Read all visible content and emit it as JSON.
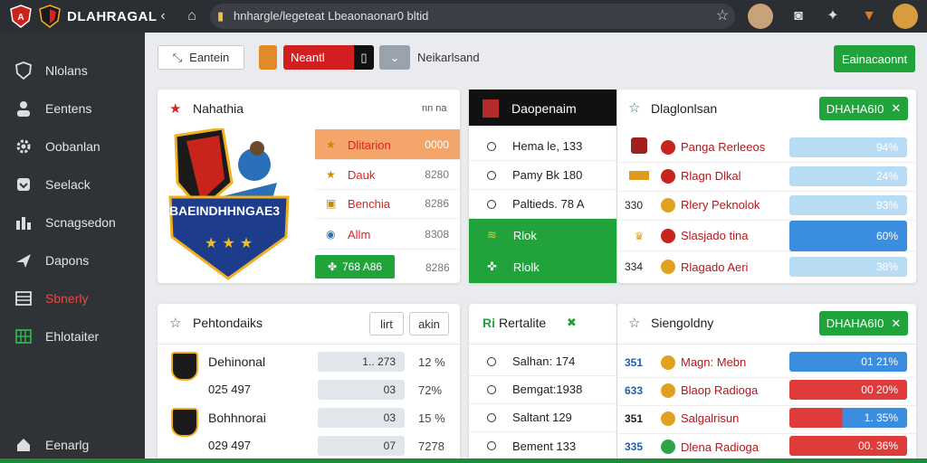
{
  "app": {
    "brand": "DLAHRAGAL"
  },
  "browser": {
    "url": "hnhargle/legeteat Lbeaonaonar0 bltid"
  },
  "colors": {
    "accent_red": "#e52b2b",
    "accent_green": "#1fa33a",
    "bar_blue": "#b9dcf5",
    "bar_strong_blue": "#3b8de0",
    "bar_red": "#e03b3b",
    "header_orange": "#f4a66a"
  },
  "sidebar": {
    "items": [
      {
        "label": "Nlolans",
        "icon": "shield-icon"
      },
      {
        "label": "Eentens",
        "icon": "users-icon"
      },
      {
        "label": "Oobanlan",
        "icon": "gear-icon"
      },
      {
        "label": "Seelack",
        "icon": "shield-outline-icon"
      },
      {
        "label": "Scnagsedon",
        "icon": "chart-icon"
      },
      {
        "label": "Dapons",
        "icon": "plane-icon"
      },
      {
        "label": "Sbnerly",
        "icon": "grid-icon"
      },
      {
        "label": "Ehlotaiter",
        "icon": "table-icon"
      },
      {
        "label": "Eenarlg",
        "icon": "home-icon"
      }
    ]
  },
  "filters": {
    "search_label": "Eantein",
    "team_label": "Neantl",
    "user_label": "Neikarlsand",
    "action_label": "Eainacaonnt"
  },
  "featured": {
    "title": "Nahathia",
    "pagination": "nn na",
    "team_banner": "BAEINDHHNGAE3",
    "menu": [
      {
        "label": "Dlitarion",
        "value": "0000"
      },
      {
        "label": "Dauk",
        "value": "8280"
      },
      {
        "label": "Benchia",
        "value": "8286"
      },
      {
        "label": "Allm",
        "value": "8308"
      },
      {
        "label": "768 A86",
        "value": "8286"
      }
    ]
  },
  "schedule": {
    "title": "Daopenaim",
    "rows": [
      {
        "label": "Hema le, 133"
      },
      {
        "label": "Pamy Bk 180"
      },
      {
        "label": "Paltieds. 78 A"
      }
    ],
    "green_rows": [
      {
        "label": "Rlok"
      },
      {
        "label": "Rlolk"
      }
    ]
  },
  "diagnostics": {
    "title": "Dlaglonlsan",
    "button": "DHAHA6I0",
    "rows": [
      {
        "num": "",
        "name": "Panga Rerleeos",
        "bar": "94%"
      },
      {
        "num": "",
        "name": "Rlagn Dlkal",
        "bar": "24%"
      },
      {
        "num": "330",
        "name": "Rlery Peknolok",
        "bar": "93%"
      },
      {
        "num": "",
        "name": "Slasjado tina",
        "bar": "60%"
      },
      {
        "num": "334",
        "name": "Rlagado Aeri",
        "bar": "38%"
      }
    ]
  },
  "standings": {
    "title": "Pehtondaiks",
    "btn1": "lirt",
    "btn2": "akin",
    "rows": [
      {
        "name": "Dehinonal",
        "sub": "",
        "mid": "1.. 273",
        "pct": "12 %"
      },
      {
        "name": "",
        "sub": "025 497",
        "mid": "03",
        "pct": "72%"
      },
      {
        "name": "Bohhnorai",
        "sub": "",
        "mid": "03",
        "pct": "15 %"
      },
      {
        "name": "",
        "sub": "029 497",
        "mid": "07",
        "pct": "7278"
      }
    ]
  },
  "results": {
    "title": "Rertalite",
    "prefix": "Ri",
    "rows": [
      {
        "label": "Salhan: 174"
      },
      {
        "label": "Bemgat:1938"
      },
      {
        "label": "Saltant 129"
      },
      {
        "label": "Bement 133"
      }
    ]
  },
  "standings2": {
    "title": "Siengoldny",
    "button": "DHAHA6I0",
    "rows": [
      {
        "num": "351",
        "name": "Magn: Mebn",
        "bar": "01  21%",
        "color": "blue"
      },
      {
        "num": "633",
        "name": "Blaop Radioga",
        "bar": "00  20%",
        "color": "red"
      },
      {
        "num": "351",
        "name": "Salgalrisun",
        "bar": "1.   35%",
        "color": "blue"
      },
      {
        "num": "335",
        "name": "Dlena Radioga",
        "bar": "00.  36%",
        "color": "red"
      }
    ]
  }
}
